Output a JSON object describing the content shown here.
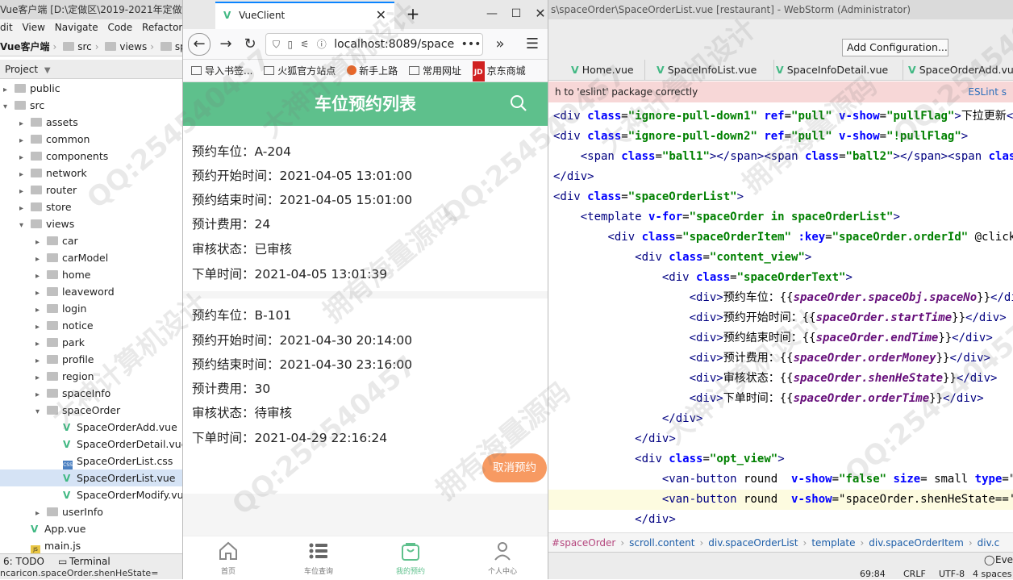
{
  "ide": {
    "title_left": "Vue客户端 [D:\\定做区\\2019-2021年定做",
    "title_right": "s\\spaceOrder\\SpaceOrderList.vue [restaurant] - WebStorm (Administrator)",
    "menu": [
      "dit",
      "View",
      "Navigate",
      "Code",
      "Refactor"
    ],
    "breadcrumb": [
      "Vue客户端",
      "src",
      "views",
      "sp"
    ],
    "project_label": "Project",
    "add_configuration": "Add Configuration...",
    "tree": [
      {
        "label": "public",
        "type": "folder",
        "indent": 0,
        "arrow": "▸"
      },
      {
        "label": "src",
        "type": "folder",
        "indent": 0,
        "arrow": "▾"
      },
      {
        "label": "assets",
        "type": "folder",
        "indent": 1,
        "arrow": "▸"
      },
      {
        "label": "common",
        "type": "folder",
        "indent": 1,
        "arrow": "▸"
      },
      {
        "label": "components",
        "type": "folder",
        "indent": 1,
        "arrow": "▸"
      },
      {
        "label": "network",
        "type": "folder",
        "indent": 1,
        "arrow": "▸"
      },
      {
        "label": "router",
        "type": "folder",
        "indent": 1,
        "arrow": "▸"
      },
      {
        "label": "store",
        "type": "folder",
        "indent": 1,
        "arrow": "▸"
      },
      {
        "label": "views",
        "type": "folder",
        "indent": 1,
        "arrow": "▾"
      },
      {
        "label": "car",
        "type": "folder",
        "indent": 2,
        "arrow": "▸"
      },
      {
        "label": "carModel",
        "type": "folder",
        "indent": 2,
        "arrow": "▸"
      },
      {
        "label": "home",
        "type": "folder",
        "indent": 2,
        "arrow": "▸"
      },
      {
        "label": "leaveword",
        "type": "folder",
        "indent": 2,
        "arrow": "▸"
      },
      {
        "label": "login",
        "type": "folder",
        "indent": 2,
        "arrow": "▸"
      },
      {
        "label": "notice",
        "type": "folder",
        "indent": 2,
        "arrow": "▸"
      },
      {
        "label": "park",
        "type": "folder",
        "indent": 2,
        "arrow": "▸"
      },
      {
        "label": "profile",
        "type": "folder",
        "indent": 2,
        "arrow": "▸"
      },
      {
        "label": "region",
        "type": "folder",
        "indent": 2,
        "arrow": "▸"
      },
      {
        "label": "spaceInfo",
        "type": "folder",
        "indent": 2,
        "arrow": "▸"
      },
      {
        "label": "spaceOrder",
        "type": "folder",
        "indent": 2,
        "arrow": "▾"
      },
      {
        "label": "SpaceOrderAdd.vue",
        "type": "vue",
        "indent": 3,
        "arrow": ""
      },
      {
        "label": "SpaceOrderDetail.vue",
        "type": "vue",
        "indent": 3,
        "arrow": ""
      },
      {
        "label": "SpaceOrderList.css",
        "type": "css",
        "indent": 3,
        "arrow": ""
      },
      {
        "label": "SpaceOrderList.vue",
        "type": "vue",
        "indent": 3,
        "arrow": "",
        "selected": true
      },
      {
        "label": "SpaceOrderModify.vu",
        "type": "vue",
        "indent": 3,
        "arrow": ""
      },
      {
        "label": "userInfo",
        "type": "folder",
        "indent": 2,
        "arrow": "▸"
      },
      {
        "label": "App.vue",
        "type": "vue",
        "indent": 1,
        "arrow": ""
      },
      {
        "label": "main.js",
        "type": "js",
        "indent": 1,
        "arrow": ""
      }
    ],
    "bottom_todo": "6: TODO",
    "bottom_terminal": "Terminal",
    "status_text": "ncaricon.spaceOrder.shenHeState=",
    "editor_tabs": [
      "Home.vue",
      "SpaceInfoList.vue",
      "SpaceInfoDetail.vue",
      "SpaceOrderAdd.vue"
    ],
    "eslint_msg": "h to 'eslint' package correctly",
    "eslint_link": "ESLint s",
    "editor_crumbs": [
      "#spaceOrder",
      "scroll.content",
      "div.spaceOrderList",
      "template",
      "div.spaceOrderItem",
      "div.c"
    ],
    "status_right": [
      "69:84",
      "CRLF",
      "UTF-8",
      "4 spaces"
    ],
    "event_label": "Eve"
  },
  "browser": {
    "tab_title": "VueClient",
    "url": "localhost:8089/space",
    "bookmarks": [
      "导入书签...",
      "火狐官方站点",
      "新手上路",
      "常用网址",
      "京东商城"
    ]
  },
  "app": {
    "title": "车位预约列表",
    "orders": [
      {
        "space_label": "预约车位：",
        "space": "A-204",
        "start_label": "预约开始时间：",
        "start": "2021-04-05 13:01:00",
        "end_label": "预约结束时间：",
        "end": "2021-04-05 15:01:00",
        "money_label": "预计费用：",
        "money": "24",
        "state_label": "审核状态：",
        "state": "已审核",
        "time_label": "下单时间：",
        "time": "2021-04-05 13:01:39"
      },
      {
        "space_label": "预约车位：",
        "space": "B-101",
        "start_label": "预约开始时间：",
        "start": "2021-04-30 20:14:00",
        "end_label": "预约结束时间：",
        "end": "2021-04-30 23:16:00",
        "money_label": "预计费用：",
        "money": "30",
        "state_label": "审核状态：",
        "state": "待审核",
        "time_label": "下单时间：",
        "time": "2021-04-29 22:16:24"
      }
    ],
    "cancel_button": "取消预约",
    "tabs": [
      {
        "label": "首页",
        "icon": "home-icon"
      },
      {
        "label": "车位查询",
        "icon": "list-icon"
      },
      {
        "label": "我的预约",
        "icon": "bag-icon",
        "active": true
      },
      {
        "label": "个人中心",
        "icon": "user-icon"
      }
    ]
  },
  "code_lines": [
    "<div class=\"ignore-pull-down1\" ref=\"pull\" v-show=\"pullFlag\">下拉更新</d",
    "<div class=\"ignore-pull-down2\" ref=\"pull\" v-show=\"!pullFlag\">",
    "    <span class=\"ball1\"></span><span class=\"ball2\"></span><span class=\"b",
    "</div>",
    "<div class=\"spaceOrderList\">",
    "    <template v-for=\"spaceOrder in spaceOrderList\">",
    "        <div class=\"spaceOrderItem\" :key=\"spaceOrder.orderId\" @click.sto",
    "            <div class=\"content_view\">",
    "                <div class=\"spaceOrderText\">",
    "                    <div>预约车位：{{spaceOrder.spaceObj.spaceNo}}</div>",
    "                    <div>预约开始时间：{{spaceOrder.startTime}}</div>",
    "                    <div>预约结束时间：{{spaceOrder.endTime}}</div>",
    "                    <div>预计费用：{{spaceOrder.orderMoney}}</div>",
    "                    <div>审核状态：{{spaceOrder.shenHeState}}</div>",
    "                    <div>下单时间：{{spaceOrder.orderTime}}</div>",
    "                </div>",
    "            </div>",
    "            <div class=\"opt_view\">",
    "                <van-button round  v-show=\"false\" size= small type=\"prin",
    "                <van-button round  v-show=\"spaceOrder.shenHeState=='待审",
    "            </div>"
  ],
  "watermarks": [
    "QQ:254540457",
    "大神计算机设计",
    "拥有海量源码",
    "QQ:254540457",
    "大神计算机设计",
    "拥有海量源码",
    "QQ:254540457",
    "大神计算机设计",
    "QQ:254540457",
    "拥有海量源码",
    "大神计算机设计",
    "QQ:254540457"
  ]
}
